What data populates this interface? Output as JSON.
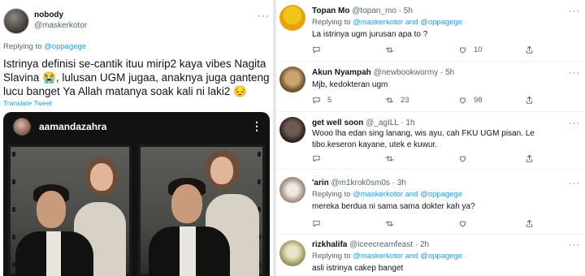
{
  "main_tweet": {
    "author_name": "nobody",
    "author_handle": "@maskerkotor",
    "replying_prefix": "Replying to",
    "replying_to": "@oppagege",
    "text": "Istrinya definisi se-cantik ituu mirip2 kaya vibes Nagita Slavina 😭, lulusan UGM jugaa, anaknya juga ganteng lucu banget Ya Allah matanya soak kali ni laki2 😔",
    "translate_label": "Translate Tweet",
    "media": {
      "ig_username": "aamandazahra"
    }
  },
  "replies": [
    {
      "name": "Topan Mo",
      "handle": "@topan_mo",
      "time": "5h",
      "replying_prefix": "Replying to",
      "replying_to": "@maskerkotor and @oppagege",
      "text": "La istrinya ugm jurusan apa to ?",
      "reply_count": "",
      "retweet_count": "",
      "like_count": "10"
    },
    {
      "name": "Akun Nyampah",
      "handle": "@newbookwormy",
      "time": "5h",
      "replying_prefix": "",
      "replying_to": "",
      "text": "Mjb, kedokteran ugm",
      "reply_count": "5",
      "retweet_count": "23",
      "like_count": "98"
    },
    {
      "name": "get well soon",
      "handle": "@_agILL",
      "time": "1h",
      "replying_prefix": "",
      "replying_to": "",
      "text": "Wooo lha edan sing lanang, wis ayu, cah FKU UGM pisan. Le tibo.keseron kayane, utek e kuwur.",
      "reply_count": "",
      "retweet_count": "",
      "like_count": ""
    },
    {
      "name": "'arin",
      "handle": "@m1krok0sm0s",
      "time": "3h",
      "replying_prefix": "Replying to",
      "replying_to": "@maskerkotor and @oppagege",
      "text": "mereka berdua ni sama sama dokter kah ya?",
      "reply_count": "",
      "retweet_count": "",
      "like_count": ""
    },
    {
      "name": "rizkhalifa",
      "handle": "@iceecreamfeast",
      "time": "2h",
      "replying_prefix": "Replying to",
      "replying_to": "@maskerkotor and @oppagege",
      "text": "asli istrinya cakep banget",
      "reply_count": "",
      "retweet_count": "",
      "like_count": ""
    }
  ],
  "colors": {
    "link": "#1d9bf0",
    "secondary_text": "#536471",
    "primary_text": "#0f1419",
    "divider": "#e6e6e6"
  }
}
